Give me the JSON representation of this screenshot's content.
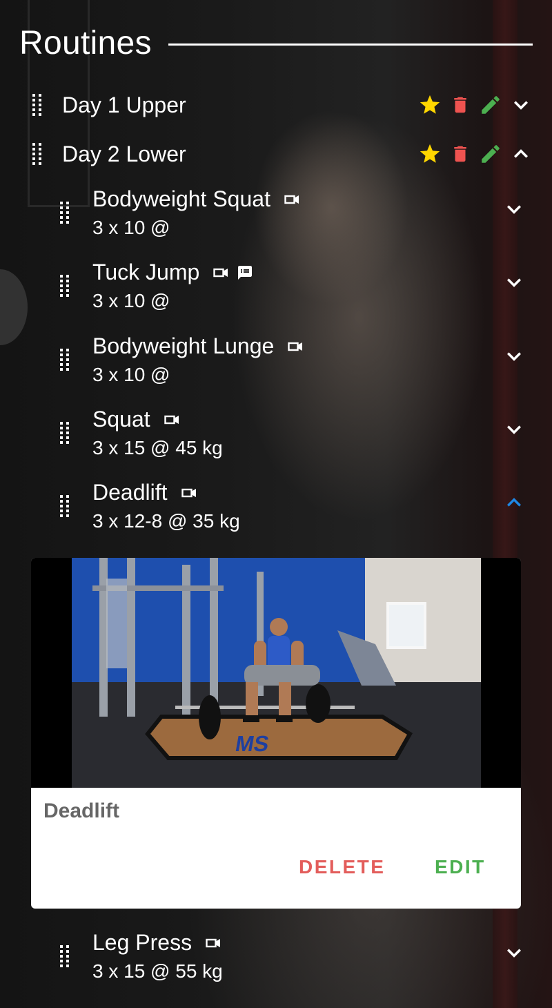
{
  "header": {
    "title": "Routines"
  },
  "routines": [
    {
      "name": "Day 1 Upper",
      "expanded": false,
      "icons": [
        "drag-handle-icon",
        "star-icon",
        "trash-icon",
        "pencil-icon",
        "chevron-down-icon"
      ]
    },
    {
      "name": "Day 2 Lower",
      "expanded": true,
      "icons": [
        "drag-handle-icon",
        "star-icon",
        "trash-icon",
        "pencil-icon",
        "chevron-up-icon"
      ]
    }
  ],
  "exercises": [
    {
      "name": "Bodyweight Squat",
      "detail": "3 x 10 @",
      "has_video": true,
      "has_notes": false,
      "expanded": false
    },
    {
      "name": "Tuck Jump",
      "detail": "3 x 10 @",
      "has_video": true,
      "has_notes": true,
      "expanded": false
    },
    {
      "name": "Bodyweight Lunge",
      "detail": "3 x 10 @",
      "has_video": true,
      "has_notes": false,
      "expanded": false
    },
    {
      "name": "Squat",
      "detail": "3 x 15 @ 45 kg",
      "has_video": true,
      "has_notes": false,
      "expanded": false
    },
    {
      "name": "Deadlift",
      "detail": "3 x 12-8 @ 35 kg",
      "has_video": true,
      "has_notes": false,
      "expanded": true
    },
    {
      "name": "Leg Press",
      "detail": "3 x 15 @ 55 kg",
      "has_video": true,
      "has_notes": false,
      "expanded": false
    }
  ],
  "detail_card": {
    "title": "Deadlift",
    "delete_label": "DELETE",
    "edit_label": "EDIT"
  },
  "colors": {
    "star": "#FFD600",
    "trash": "#EF5350",
    "edit": "#4CAF50",
    "delete_text": "#E35D5B",
    "edit_text": "#4CAF50",
    "chevron_active": "#1E88E5"
  }
}
